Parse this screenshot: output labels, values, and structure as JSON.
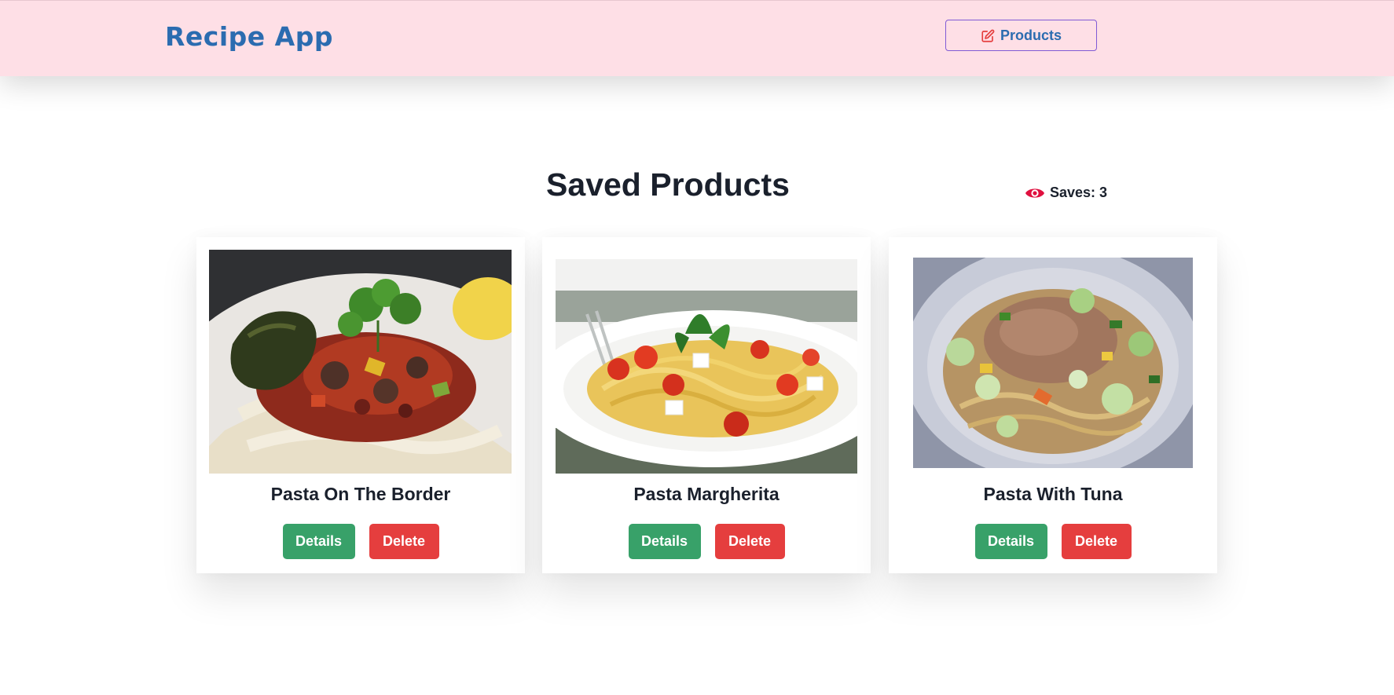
{
  "header": {
    "brand": "Recipe App",
    "nav_button_label": "Products",
    "nav_button_icon": "edit-icon"
  },
  "main": {
    "title": "Saved Products",
    "saves_label": "Saves: 3",
    "saves_icon": "eye-icon",
    "cards": [
      {
        "title": "Pasta On The Border",
        "details_label": "Details",
        "delete_label": "Delete"
      },
      {
        "title": "Pasta Margherita",
        "details_label": "Details",
        "delete_label": "Delete"
      },
      {
        "title": "Pasta With Tuna",
        "details_label": "Details",
        "delete_label": "Delete"
      }
    ]
  },
  "colors": {
    "header_bg": "#fedfe6",
    "brand": "#2b6cb0",
    "nav_border": "#805ad5",
    "details": "#38a169",
    "delete": "#e53e3e",
    "eye_icon": "#e0103f"
  }
}
